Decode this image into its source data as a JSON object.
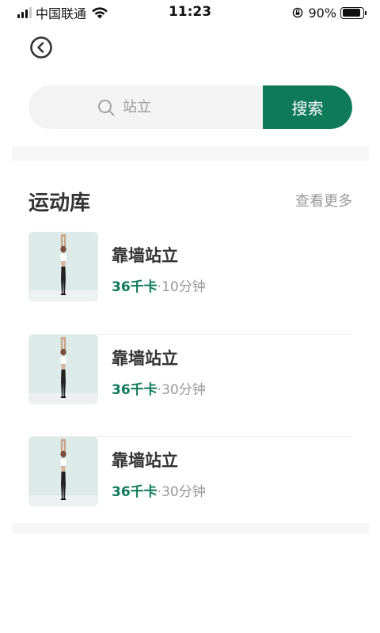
{
  "status_bar": {
    "carrier": "中国联通",
    "time": "11:23",
    "battery": "90%",
    "battery_level": 0.9,
    "icons": [
      "signal-icon",
      "wifi-icon",
      "rotation-lock-icon",
      "battery-icon"
    ]
  },
  "nav": {
    "back_icon": "back-circle-icon"
  },
  "search": {
    "placeholder": "站立",
    "button_label": "搜索",
    "icon": "search-icon"
  },
  "section": {
    "title": "运动库",
    "more_label": "查看更多"
  },
  "exercises": [
    {
      "title": "靠墙站立",
      "kcal": "36千卡",
      "separator": "·",
      "duration": "10分钟",
      "thumbnail": "standing-pose-thumbnail"
    },
    {
      "title": "靠墙站立",
      "kcal": "36千卡",
      "separator": "·",
      "duration": "30分钟",
      "thumbnail": "standing-pose-thumbnail"
    },
    {
      "title": "靠墙站立",
      "kcal": "36千卡",
      "separator": "·",
      "duration": "30分钟",
      "thumbnail": "standing-pose-thumbnail"
    }
  ],
  "colors": {
    "accent": "#0e7a58",
    "search_bg": "#f3f3f3",
    "thumb_bg": "#dcebe8",
    "muted_text": "#999999"
  }
}
